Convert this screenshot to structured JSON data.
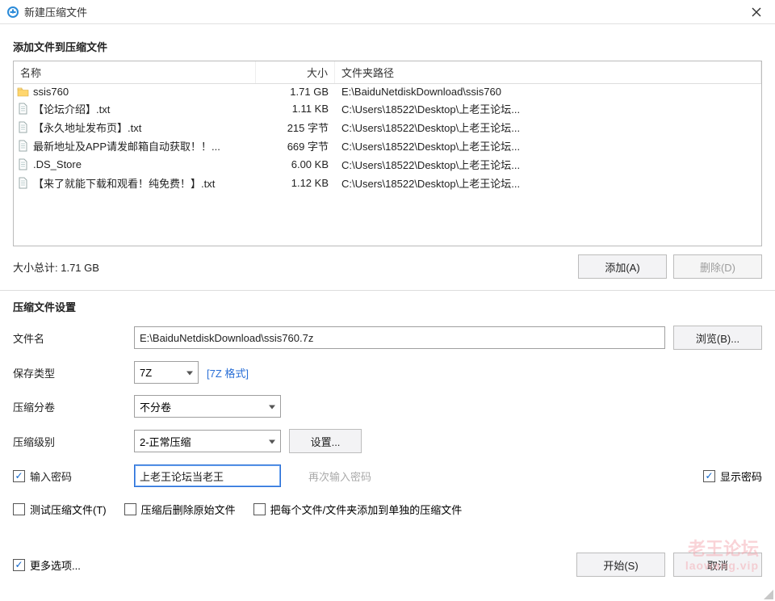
{
  "titlebar": {
    "title": "新建压缩文件"
  },
  "sections": {
    "add_files": "添加文件到压缩文件",
    "settings": "压缩文件设置"
  },
  "columns": {
    "name": "名称",
    "size": "大小",
    "path": "文件夹路径"
  },
  "files": [
    {
      "icon": "folder",
      "name": "ssis760",
      "size": "1.71 GB",
      "path": "E:\\BaiduNetdiskDownload\\ssis760"
    },
    {
      "icon": "file",
      "name": "【论坛介绍】.txt",
      "size": "1.11 KB",
      "path": "C:\\Users\\18522\\Desktop\\上老王论坛..."
    },
    {
      "icon": "file",
      "name": "【永久地址发布页】.txt",
      "size": "215 字节",
      "path": "C:\\Users\\18522\\Desktop\\上老王论坛..."
    },
    {
      "icon": "file",
      "name": "最新地址及APP请发邮箱自动获取！！...",
      "size": "669 字节",
      "path": "C:\\Users\\18522\\Desktop\\上老王论坛..."
    },
    {
      "icon": "file",
      "name": ".DS_Store",
      "size": "6.00 KB",
      "path": "C:\\Users\\18522\\Desktop\\上老王论坛..."
    },
    {
      "icon": "file",
      "name": "【来了就能下载和观看！纯免费！】.txt",
      "size": "1.12 KB",
      "path": "C:\\Users\\18522\\Desktop\\上老王论坛..."
    }
  ],
  "total_size": "大小总计: 1.71 GB",
  "buttons": {
    "add": "添加(A)",
    "remove": "删除(D)",
    "browse": "浏览(B)...",
    "config": "设置...",
    "start": "开始(S)",
    "cancel": "取消"
  },
  "labels": {
    "filename": "文件名",
    "save_type": "保存类型",
    "split": "压缩分卷",
    "level": "压缩级别",
    "enter_password": "输入密码",
    "reenter_password_placeholder": "再次输入密码",
    "show_password": "显示密码",
    "test_archive": "测试压缩文件(T)",
    "delete_after": "压缩后删除原始文件",
    "each_separate": "把每个文件/文件夹添加到单独的压缩文件",
    "more_options": "更多选项..."
  },
  "values": {
    "filename": "E:\\BaiduNetdiskDownload\\ssis760.7z",
    "save_type": "7Z",
    "format_link": "[7Z 格式]",
    "split": "不分卷",
    "level": "2-正常压缩",
    "password": "上老王论坛当老王"
  },
  "checks": {
    "enter_password": true,
    "show_password": true,
    "test_archive": false,
    "delete_after": false,
    "each_separate": false,
    "more_options": true
  },
  "watermark": {
    "line1": "老王论坛",
    "line2": "laowang.vip"
  }
}
